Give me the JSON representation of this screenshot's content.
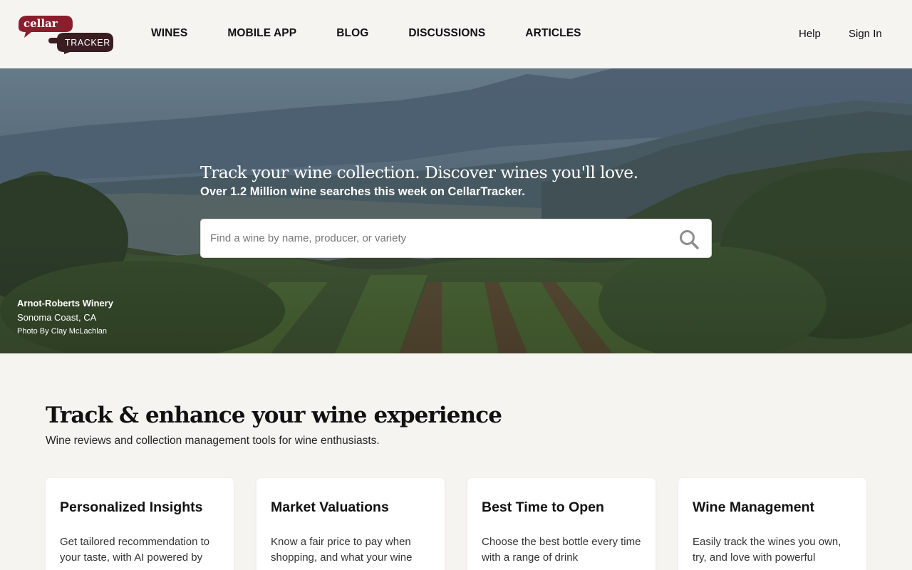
{
  "brand": {
    "logo_top": "cellar",
    "logo_bottom": "TRACKER",
    "colors": {
      "maroon": "#8b1e2d",
      "dark": "#3a1d20"
    }
  },
  "nav": {
    "items": [
      {
        "label": "WINES"
      },
      {
        "label": "MOBILE APP"
      },
      {
        "label": "BLOG"
      },
      {
        "label": "DISCUSSIONS"
      },
      {
        "label": "ARTICLES"
      }
    ],
    "help": "Help",
    "sign_in": "Sign In"
  },
  "hero": {
    "title": "Track your wine collection. Discover wines you'll love.",
    "subtitle": "Over 1.2 Million wine searches this week on CellarTracker.",
    "search_placeholder": "Find a wine by name, producer, or variety",
    "search_icon": "search-icon",
    "credit": {
      "name": "Arnot-Roberts Winery",
      "location": "Sonoma Coast, CA",
      "photo": "Photo By Clay McLachlan"
    }
  },
  "section": {
    "title": "Track & enhance your wine experience",
    "subtitle": "Wine reviews and collection management tools for wine enthusiasts."
  },
  "features": [
    {
      "title": "Personalized Insights",
      "text": "Get tailored recommendation to your taste, with AI powered by"
    },
    {
      "title": "Market Valuations",
      "text": "Know a fair price to pay when shopping, and what your wine"
    },
    {
      "title": "Best Time to Open",
      "text": "Choose the best bottle every time with a range of drink"
    },
    {
      "title": "Wine Management",
      "text": "Easily track the wines you own, try, and love with powerful"
    }
  ]
}
